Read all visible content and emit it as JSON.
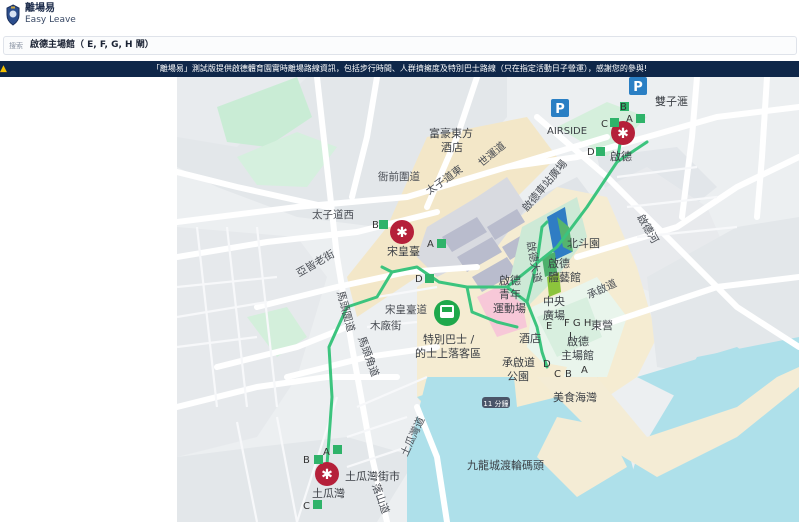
{
  "header": {
    "app_title": "離場易",
    "app_subtitle": "Easy Leave"
  },
  "search": {
    "prefix": "搜索",
    "value": "啟德主場館（ E, F, G, H 閘）"
  },
  "banner": {
    "text": "「離場易」測試版提供啟德體育園實時離場路線資訊，包括步行時間、人群擠擁度及特別巴士路線（只在指定活動日子營運），感謝您的參與!"
  },
  "map": {
    "colors": {
      "route": "#35c07a",
      "mtr": "#b5203a",
      "bus": "#1fa84b",
      "parking": "#2a7fc4"
    },
    "labels": {
      "fu_hao_dong_fang": "富豪東方",
      "jiu_dian": "酒店",
      "shi_gao_dao": "世運道",
      "tai_zi_dao_dong": "太子道東",
      "ji_qian_wei_dao": "衙前圍道",
      "tai_zi_dao_xi": "太子道西",
      "ya_huang_lao_jie": "亞皆老街",
      "song_huang_tai": "宋皇臺",
      "song_huang_tai_dao": "宋皇臺道",
      "ma_tou_wei_dao": "馬頭圍道",
      "mu_chang_jie": "木廠街",
      "ma_tou_jiao_dao": "馬頭角道",
      "te_bie_ba_shi": "特別巴士 /",
      "de_shi_shang_luo": "的士上落客區",
      "airside": "AIRSIDE",
      "shuang_zi_hui": "雙子滙",
      "qi_de": "啟德",
      "qi_de_che_zhan": "啟德車站廣場",
      "qi_de_he": "啟德河",
      "bei_dou_yuan": "北斗園",
      "qi_de_ti_yi_guan_1": "啟德",
      "qi_de_ti_yi_guan_2": "體藝館",
      "qi_de_qing_nian_1": "啟德",
      "qi_de_qing_nian_2": "青年",
      "qi_de_qing_nian_3": "運動場",
      "zhong_yang_1": "中央",
      "zhong_yang_2": "廣場",
      "cheng_qi_dao": "承啟道",
      "dong_ying": "東營",
      "qi_de_zhu_chang_guan_1": "啟德",
      "qi_de_zhu_chang_guan_2": "主場館",
      "jiu_dian_2": "酒店",
      "cheng_qi_dao_gong_yuan_1": "承啟道",
      "cheng_qi_dao_gong_yuan_2": "公園",
      "mei_shi_hai_wan": "美食海灣",
      "tu_gua_wan_jie_shi": "土瓜灣街市",
      "tu_gua_wan": "土瓜灣",
      "tu_gua_wan_dao": "土瓜灣道",
      "jiu_long_cheng_du_lun": "九龍城渡輪碼頭",
      "lu_shan_dao": "落山道",
      "cheng_qi_dao_road": "承啟道",
      "qi_de_shu_xiu": "啟德大道",
      "shi_zhong": "11 分鐘"
    },
    "exits": {
      "B1": "B",
      "A1": "A",
      "D1": "D",
      "B2": "B",
      "A2": "A",
      "C2": "C",
      "D2": "D",
      "B3": "B",
      "A3": "A",
      "C3": "C",
      "gates": "F G H",
      "gate_e": "E",
      "gate_j": "J",
      "gate_c": "C",
      "gate_b": "B",
      "gate_a": "A",
      "gate_d": "D"
    }
  }
}
